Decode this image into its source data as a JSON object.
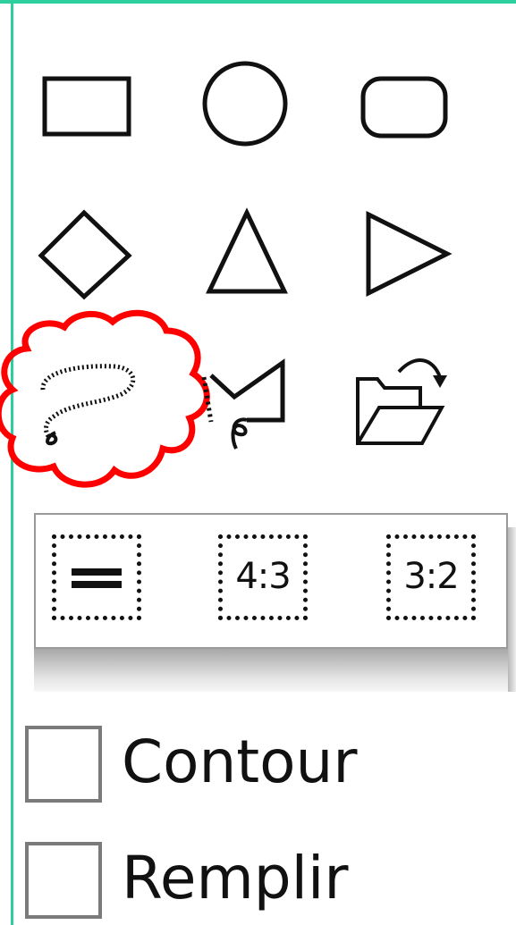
{
  "tools": [
    {
      "name": "rectangle",
      "icon": "rectangle-icon"
    },
    {
      "name": "ellipse",
      "icon": "ellipse-icon"
    },
    {
      "name": "rounded-rectangle",
      "icon": "rounded-rectangle-icon"
    },
    {
      "name": "diamond",
      "icon": "diamond-icon"
    },
    {
      "name": "triangle",
      "icon": "triangle-icon"
    },
    {
      "name": "right-triangle",
      "icon": "right-triangle-icon"
    },
    {
      "name": "freeform-lasso",
      "icon": "lasso-icon",
      "highlighted": true
    },
    {
      "name": "polygon-lasso",
      "icon": "polygon-lasso-icon"
    },
    {
      "name": "open-image",
      "icon": "open-folder-icon"
    }
  ],
  "crop_ratios": [
    {
      "label": "",
      "icon": "equal-icon"
    },
    {
      "label": "4:3",
      "icon": "ratio-4-3-icon"
    },
    {
      "label": "3:2",
      "icon": "ratio-3-2-icon"
    }
  ],
  "options": {
    "contour_label": "Contour",
    "contour_checked": false,
    "fill_label": "Remplir",
    "fill_checked": false
  },
  "colors": {
    "frame": "#2ecf9e",
    "highlight": "#ff0000",
    "checkbox_border": "#7b7b7b"
  }
}
